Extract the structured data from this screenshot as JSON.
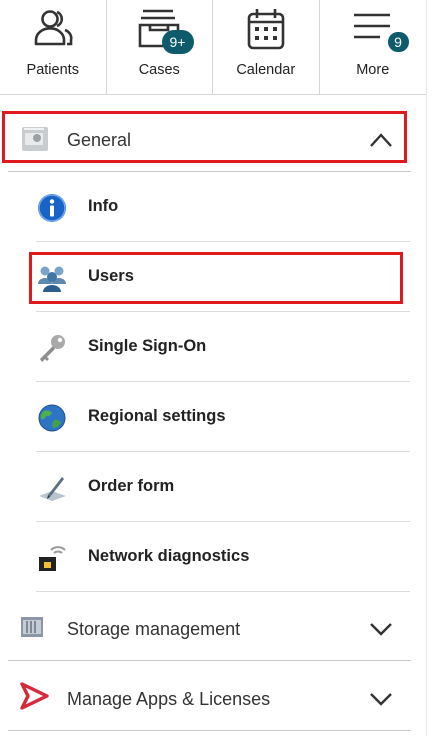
{
  "topnav": {
    "patients": {
      "label": "Patients"
    },
    "cases": {
      "label": "Cases",
      "badge": "9+"
    },
    "calendar": {
      "label": "Calendar"
    },
    "more": {
      "label": "More",
      "badge": "9"
    }
  },
  "general": {
    "label": "General",
    "items": [
      {
        "label": "Info"
      },
      {
        "label": "Users"
      },
      {
        "label": "Single Sign-On"
      },
      {
        "label": "Regional settings"
      },
      {
        "label": "Order form"
      },
      {
        "label": "Network diagnostics"
      }
    ]
  },
  "storage": {
    "label": "Storage management"
  },
  "apps": {
    "label": "Manage Apps & Licenses"
  },
  "colors": {
    "accent": "#0d5b6b",
    "highlight": "#e0191f",
    "brand": "#d42a3b"
  }
}
